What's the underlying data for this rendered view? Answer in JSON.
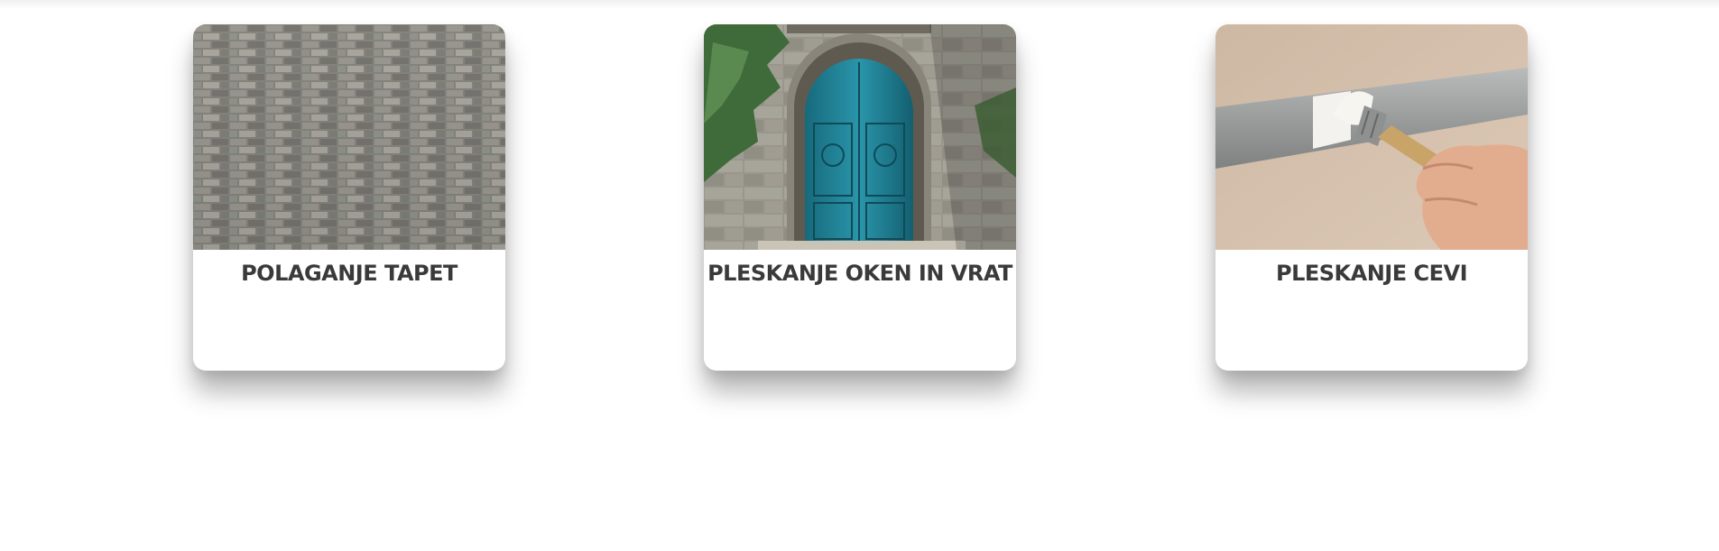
{
  "cards": [
    {
      "title": "POLAGANJE TAPET",
      "image": "stone-brick-wall"
    },
    {
      "title": "PLESKANJE OKEN IN VRAT",
      "image": "arched-teal-door"
    },
    {
      "title": "PLESKANJE CEVI",
      "image": "painting-pipe-with-brush"
    }
  ],
  "colors": {
    "title_text": "#3a3a3a",
    "card_background": "#ffffff",
    "door_teal": "#1f7f93"
  }
}
